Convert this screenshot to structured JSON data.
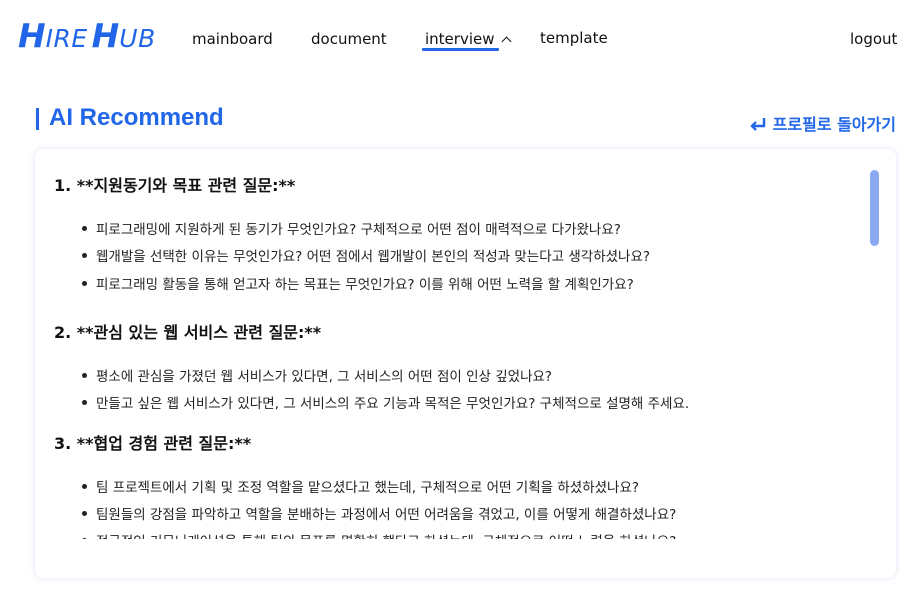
{
  "logo": {
    "letter_h": "H",
    "rest_ire": "IRE",
    "rest_ub": "UB"
  },
  "nav": {
    "mainboard": "mainboard",
    "document": "document",
    "interview": "interview",
    "template": "template",
    "logout": "logout"
  },
  "page": {
    "title": "AI Recommend",
    "back_label": "프로필로 돌아가기"
  },
  "sections": [
    {
      "heading": "1. **지원동기와 목표 관련 질문:**",
      "items": [
        "피로그래밍에 지원하게 된 동기가 무엇인가요? 구체적으로 어떤 점이 매력적으로 다가왔나요?",
        "웹개발을 선택한 이유는 무엇인가요? 어떤 점에서 웹개발이 본인의 적성과 맞는다고 생각하셨나요?",
        "피로그래밍 활동을 통해 얻고자 하는 목표는 무엇인가요? 이를 위해 어떤 노력을 할 계획인가요?"
      ]
    },
    {
      "heading": "2. **관심 있는 웹 서비스 관련 질문:**",
      "items": [
        "평소에 관심을 가졌던 웹 서비스가 있다면, 그 서비스의 어떤 점이 인상 깊었나요?",
        "만들고 싶은 웹 서비스가 있다면, 그 서비스의 주요 기능과 목적은 무엇인가요? 구체적으로 설명해 주세요."
      ]
    },
    {
      "heading": "3. **협업 경험 관련 질문:**",
      "items": [
        "팀 프로젝트에서 기획 및 조정 역할을 맡으셨다고 했는데, 구체적으로 어떤 기획을 하셨하셨나요?",
        "팀원들의 강점을 파악하고 역할을 분배하는 과정에서 어떤 어려움을 겪었고, 이를 어떻게 해결하셨나요?",
        "적극적인 커뮤니케이션을 통해 팀의 목표를 명확히 했다고 하셨는데, 구체적으로 어떤 노력을 하셨나요?"
      ]
    }
  ],
  "colors": {
    "accent": "#2166e8",
    "scroll_thumb": "#8aa9f2"
  }
}
